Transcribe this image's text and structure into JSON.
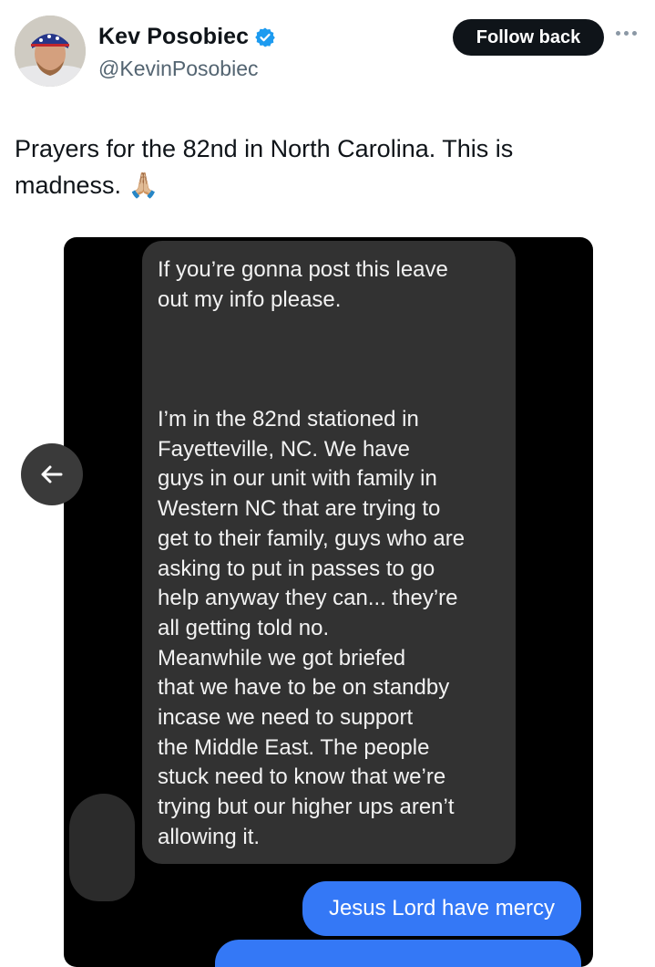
{
  "author": {
    "display_name": "Kev Posobiec",
    "handle": "@KevinPosobiec",
    "verified": true
  },
  "actions": {
    "follow_label": "Follow back",
    "more_icon": "more-horizontal-icon"
  },
  "tweet": {
    "text": "Prayers for the 82nd in North Carolina. This is madness. 🙏🏼"
  },
  "media": {
    "received_message_1": "If you’re gonna post this leave\nout my info please.",
    "received_message_2": "I’m in the 82nd stationed in\nFayetteville, NC. We have\nguys in our unit with family in\nWestern NC that are trying to\nget to their family, guys who are\nasking to put in passes to go\nhelp anyway they can... they’re\nall getting told no.\nMeanwhile we got briefed\nthat we have to be on standby\nincase we need to support\nthe Middle East. The people\nstuck need to know that we’re\ntrying but our higher ups aren’t\nallowing it.",
    "sent_message_1": "Jesus Lord have mercy"
  },
  "navigation": {
    "prev_icon": "arrow-left-icon"
  },
  "colors": {
    "follow_bg": "#0f1419",
    "verified": "#1d9bf0",
    "sent_bubble": "#3478f6",
    "received_bubble": "#323232"
  }
}
